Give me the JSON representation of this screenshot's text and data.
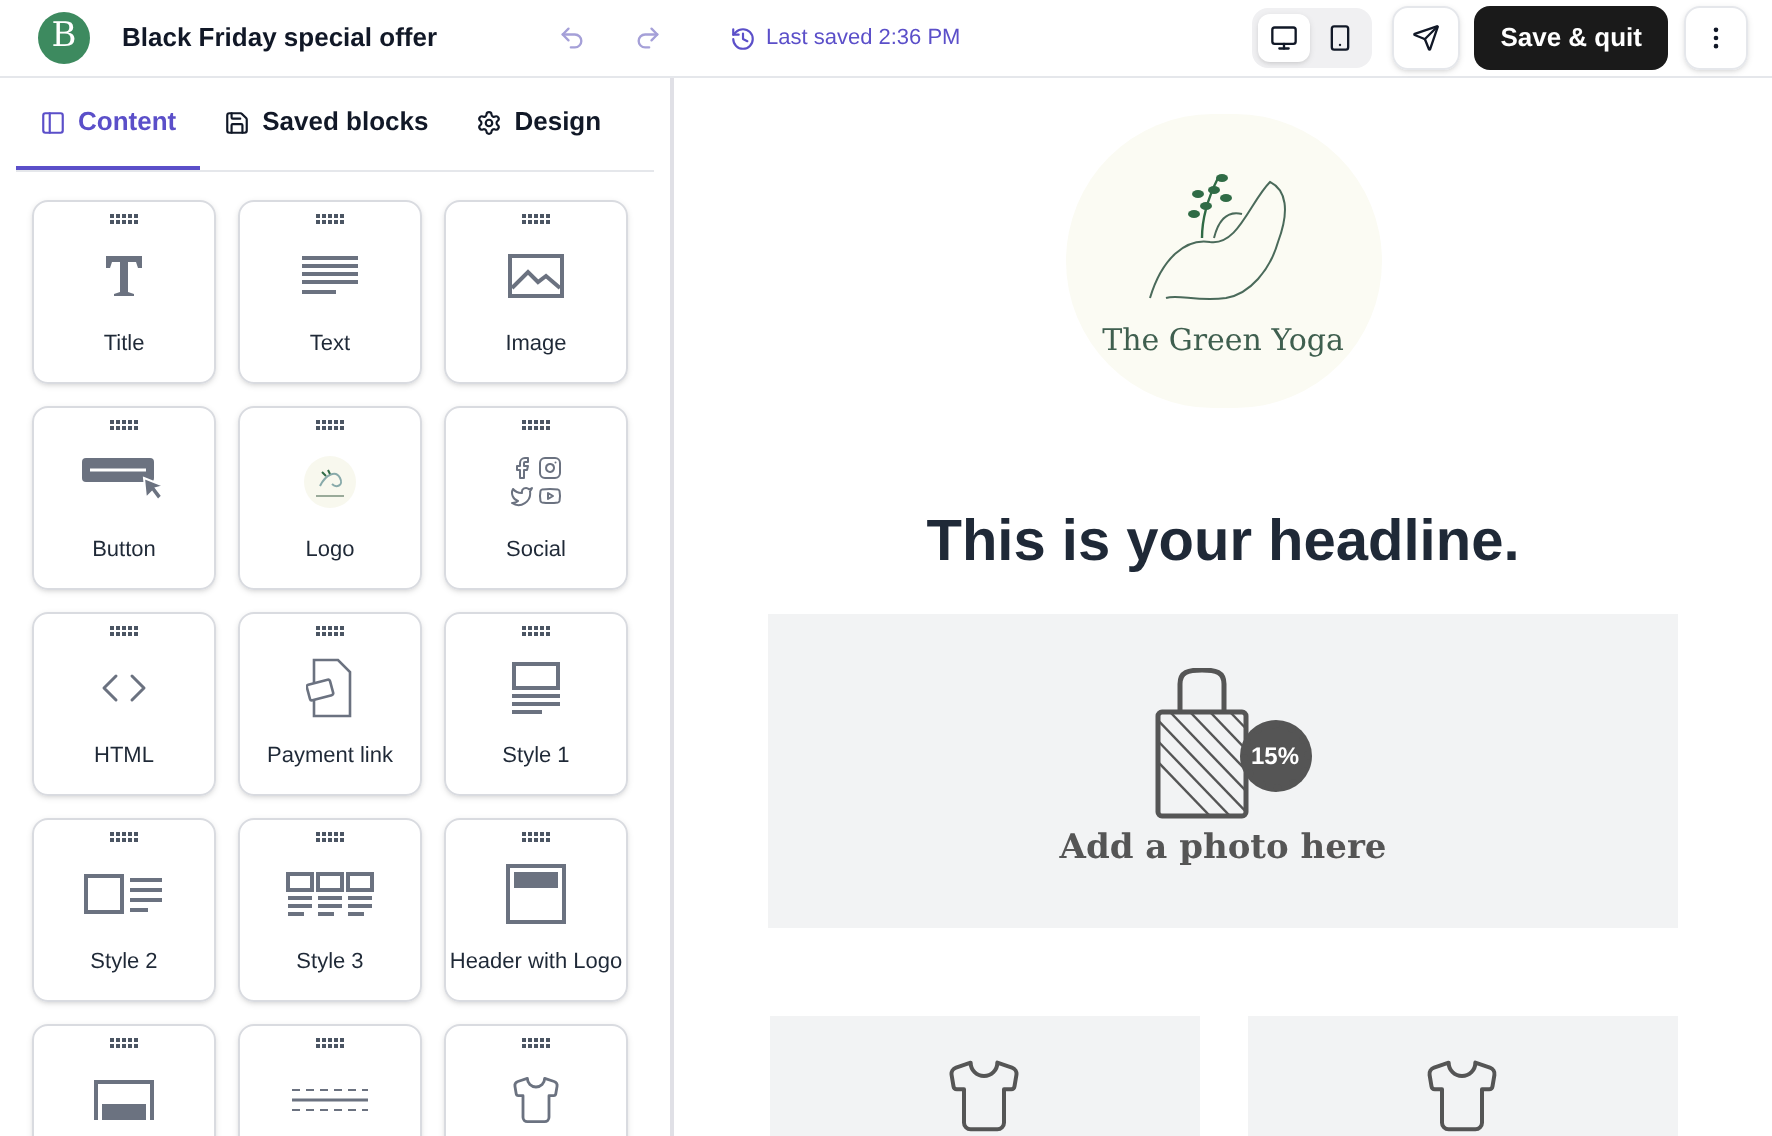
{
  "header": {
    "logo_letter": "B",
    "title": "Black Friday special offer",
    "save_status": "Last saved 2:36 PM",
    "devices": [
      {
        "kind": "desktop",
        "selected": true
      },
      {
        "kind": "mobile",
        "selected": false
      }
    ],
    "save_button": "Save & quit"
  },
  "tabs": [
    {
      "label": "Content",
      "kind": "content",
      "selected": true
    },
    {
      "label": "Saved blocks",
      "kind": "saved",
      "selected": false
    },
    {
      "label": "Design",
      "kind": "design",
      "selected": false
    }
  ],
  "blocks": [
    {
      "label": "Title",
      "kind": "title"
    },
    {
      "label": "Text",
      "kind": "text"
    },
    {
      "label": "Image",
      "kind": "image"
    },
    {
      "label": "Button",
      "kind": "button"
    },
    {
      "label": "Logo",
      "kind": "logo"
    },
    {
      "label": "Social",
      "kind": "social"
    },
    {
      "label": "HTML",
      "kind": "html"
    },
    {
      "label": "Payment link",
      "kind": "payment"
    },
    {
      "label": "Style 1",
      "kind": "style1"
    },
    {
      "label": "Style 2",
      "kind": "style2"
    },
    {
      "label": "Style 3",
      "kind": "style3"
    },
    {
      "label": "Header with Logo",
      "kind": "header"
    },
    {
      "kind": "footer"
    },
    {
      "kind": "divider"
    },
    {
      "kind": "product"
    }
  ],
  "email": {
    "logo_text": "The Green Yoga",
    "headline": "This is your headline.",
    "photo_badge": "15%",
    "photo_caption": "Add a photo here"
  }
}
